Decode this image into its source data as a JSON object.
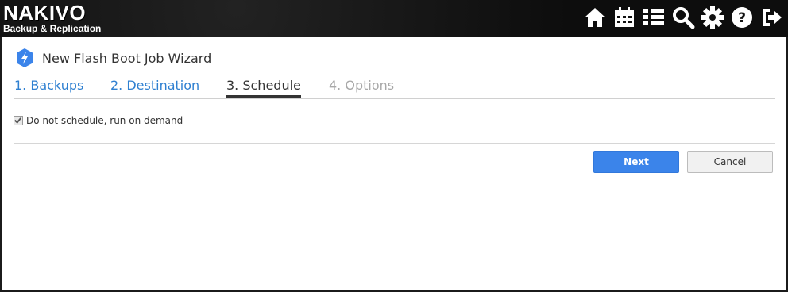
{
  "header": {
    "brand": "NAKIVO",
    "subtitle": "Backup & Replication",
    "icons": [
      "home-icon",
      "calendar-icon",
      "list-icon",
      "search-icon",
      "gear-icon",
      "help-icon",
      "logout-icon"
    ]
  },
  "wizard": {
    "title": "New Flash Boot Job Wizard",
    "steps": [
      {
        "label": "1. Backups",
        "state": "completed"
      },
      {
        "label": "2. Destination",
        "state": "completed"
      },
      {
        "label": "3. Schedule",
        "state": "active"
      },
      {
        "label": "4. Options",
        "state": "disabled"
      }
    ],
    "schedule": {
      "run_on_demand_label": "Do not schedule, run on demand",
      "run_on_demand_checked": true
    },
    "buttons": {
      "next_label": "Next",
      "cancel_label": "Cancel"
    }
  },
  "colors": {
    "accent": "#3b84ea",
    "link": "#2f80d1",
    "disabled": "#a8a8a8"
  }
}
